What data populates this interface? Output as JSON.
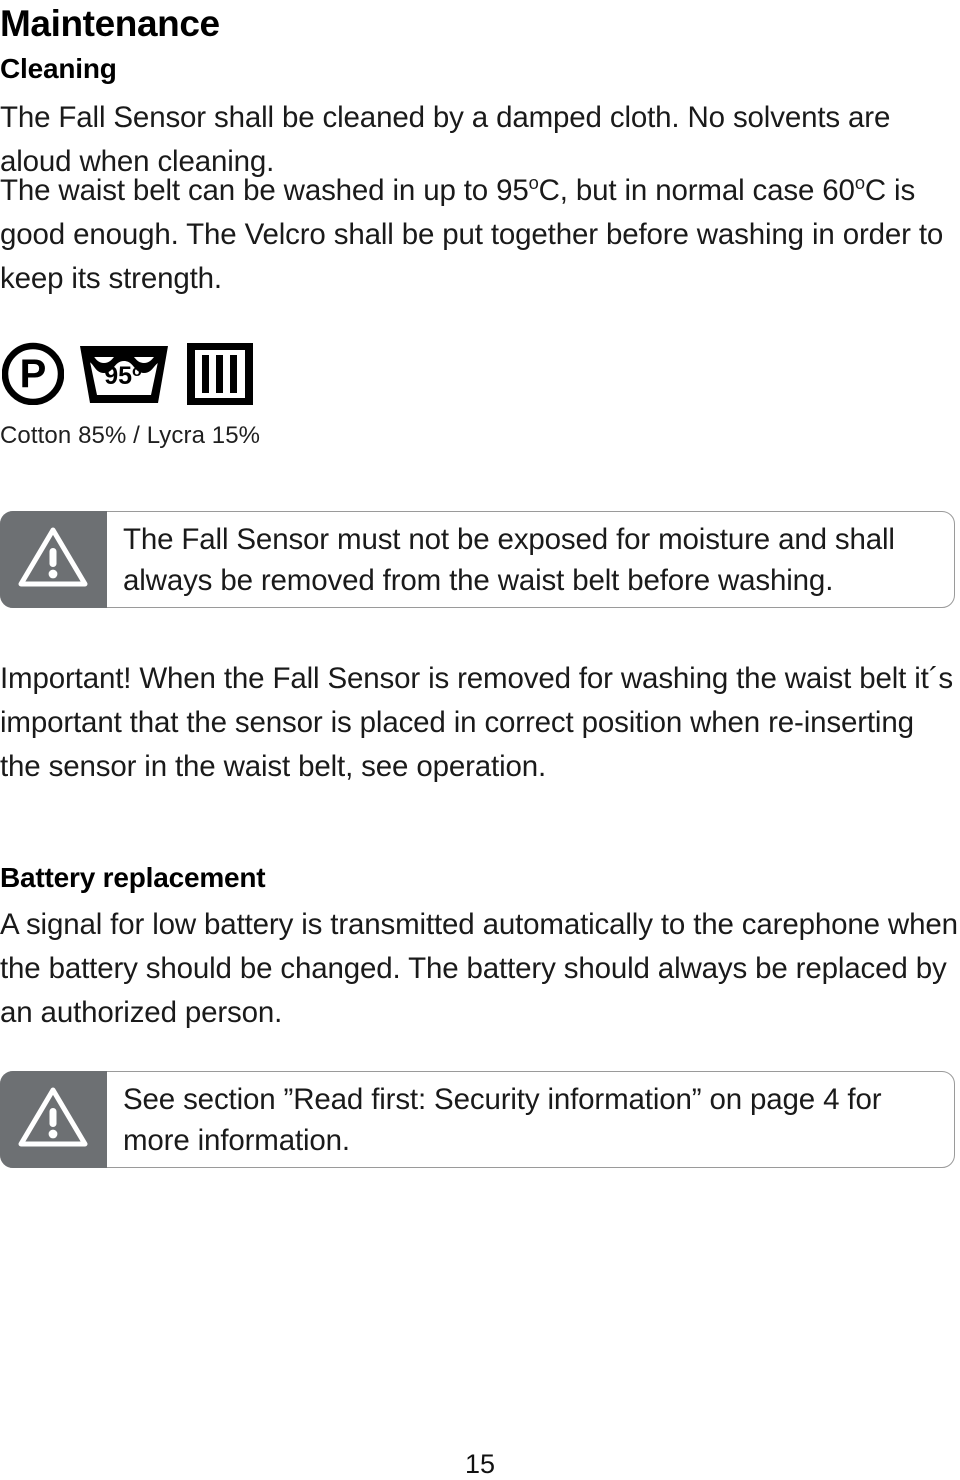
{
  "page": {
    "title": "Maintenance",
    "number": "15",
    "accent_gray": "#6d7073",
    "border_gray": "#9a9a9a",
    "text_color": "#1a1a1a"
  },
  "sections": {
    "cleaning": {
      "heading": "Cleaning",
      "paragraph_1": "The Fall Sensor shall be cleaned by a damped cloth. No solvents are aloud when cleaning.",
      "paragraph_2_part_1": "The waist belt can be washed in up to 95",
      "paragraph_2_degree_1": "o",
      "paragraph_2_part_2": "C, but in normal case 60",
      "paragraph_2_degree_2": "o",
      "paragraph_2_part_3": "C is good enough. The Velcro shall be put together before washing in order to keep its strength.",
      "important_paragraph": "Important! When the Fall Sensor is removed for washing the waist belt it´s important that the sensor is placed in correct position when re-inserting the sensor in the waist belt, see operation."
    },
    "battery": {
      "heading": "Battery replacement",
      "paragraph": "A signal for low battery is transmitted automatically to the carephone when the battery should be changed. The battery should always be replaced by an authorized person."
    }
  },
  "care_symbols": {
    "items": [
      {
        "icon": "dry-clean-p-circle-icon",
        "label": "P"
      },
      {
        "icon": "wash-tub-icon",
        "label": "95",
        "degree": "o"
      },
      {
        "icon": "drying-square-bars-icon",
        "label": ""
      }
    ],
    "fabric_note": "Cotton 85% / Lycra 15%"
  },
  "notes": [
    {
      "icon": "warning-triangle-icon",
      "text": "The Fall Sensor must not be exposed for moisture and shall always be removed from the waist belt before washing."
    },
    {
      "icon": "warning-triangle-icon",
      "text": "See section ”Read first: Security information” on page 4 for more information."
    }
  ]
}
